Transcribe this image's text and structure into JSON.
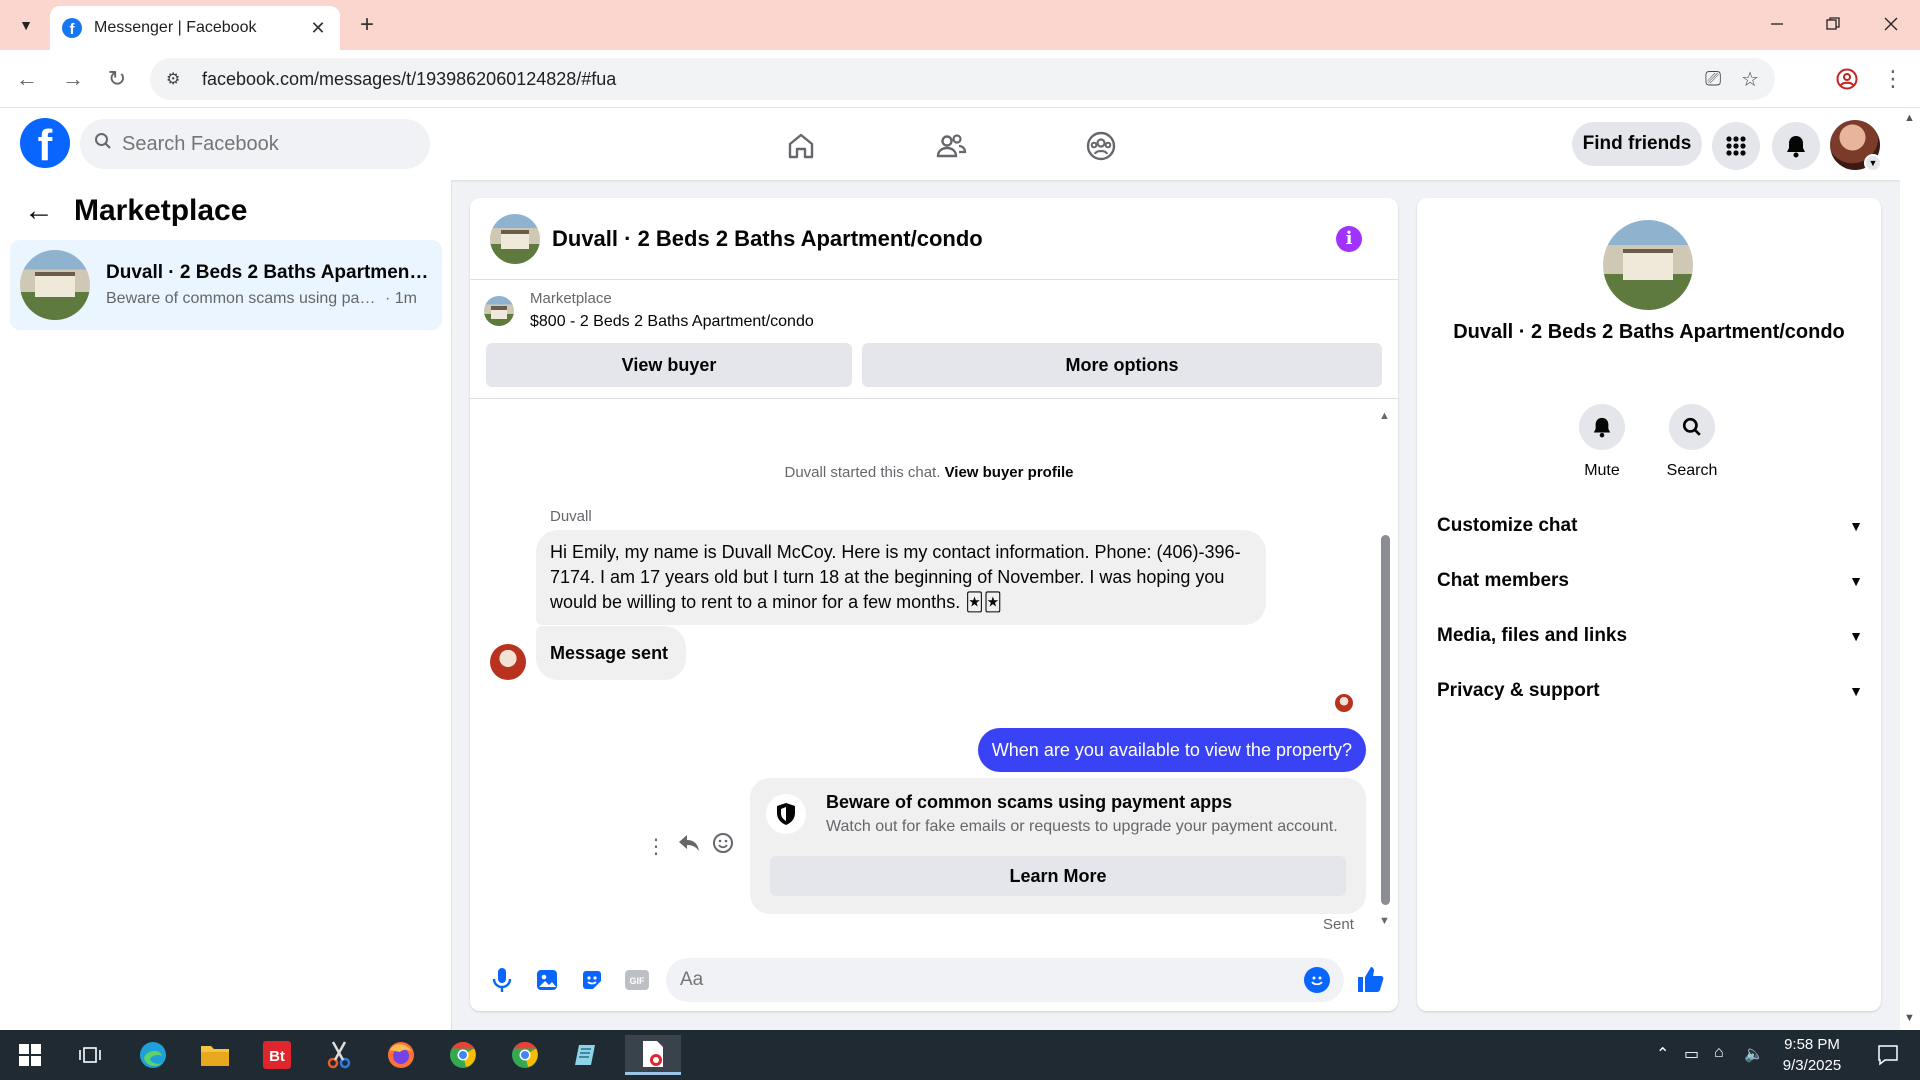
{
  "browser": {
    "tab_title": "Messenger | Facebook",
    "url": "facebook.com/messages/t/1939862060124828/#fua",
    "tab_list_icon": "chevron-down-icon",
    "new_tab_label": "+",
    "close_tab_label": "✕"
  },
  "fb_header": {
    "logo_letter": "f",
    "search_placeholder": "Search Facebook",
    "find_friends_label": "Find friends"
  },
  "left": {
    "title": "Marketplace",
    "conversation": {
      "name": "Duvall · 2 Beds 2 Baths Apartment/condo",
      "preview": "Beware of common scams using payment apps",
      "time": "· 1m"
    }
  },
  "chat": {
    "title": "Duvall · 2 Beds 2 Baths Apartment/condo",
    "listing_source": "Marketplace",
    "listing_price_title": "$800 - 2 Beds 2 Baths Apartment/condo",
    "view_buyer_label": "View buyer",
    "more_options_label": "More options",
    "system_text": "Duvall started this chat.",
    "system_link": "View buyer profile",
    "sender_name": "Duvall",
    "messages": [
      "Hi Emily, my name is Duvall McCoy. Here is my contact information. Phone: (406)-396-7174. I am 17 years old but I turn 18 at the beginning of November. I was hoping you would be willing to rent to a minor for a few months. 🃏🃏",
      "Message sent"
    ],
    "outgoing_message": "When are you available to view the property?",
    "scam_title": "Beware of common scams using payment apps",
    "scam_subtitle": "Watch out for fake emails or requests to upgrade your payment account.",
    "learn_more_label": "Learn More",
    "sent_label": "Sent",
    "composer_placeholder": "Aa"
  },
  "right": {
    "name": "Duvall · 2 Beds 2 Baths Apartment/condo",
    "mute_label": "Mute",
    "search_label": "Search",
    "sections": [
      "Customize chat",
      "Chat members",
      "Media, files and links",
      "Privacy & support"
    ]
  },
  "taskbar": {
    "time": "9:58 PM",
    "date": "9/3/2025"
  },
  "colors": {
    "fb_blue": "#0866ff",
    "outgoing_bubble": "#3a42f5",
    "info_purple": "#a033ff",
    "tabbar_bg": "#fbd6cf",
    "taskbar_bg": "#1f2a33"
  }
}
